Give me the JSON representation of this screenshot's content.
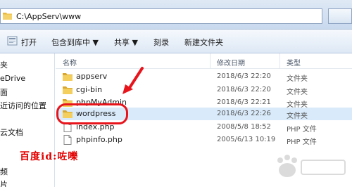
{
  "address_bar": {
    "path": "C:\\AppServ\\www"
  },
  "toolbar": {
    "open_label": "打开",
    "include_library_label": "包含到库中 ▼",
    "share_label": "共享 ▼",
    "burn_label": "刻录",
    "new_folder_label": "新建文件夹"
  },
  "nav_pane": {
    "items": [
      "夹",
      "eDrive",
      "面",
      "近访问的位置",
      "云文档",
      "",
      "频",
      "片"
    ]
  },
  "file_list": {
    "headers": {
      "name": "名称",
      "modified": "修改日期",
      "type": "类型"
    },
    "rows": [
      {
        "name": "appserv",
        "date": "2018/6/3 22:20",
        "type": "文件夹",
        "icon": "folder-icon"
      },
      {
        "name": "cgi-bin",
        "date": "2018/6/3 22:20",
        "type": "文件夹",
        "icon": "folder-icon"
      },
      {
        "name": "phpMyAdmin",
        "date": "2018/6/3 22:21",
        "type": "文件夹",
        "icon": "folder-icon"
      },
      {
        "name": "wordpress",
        "date": "2018/6/3 22:26",
        "type": "文件夹",
        "icon": "folder-icon"
      },
      {
        "name": "index.php",
        "date": "2008/5/8 18:52",
        "type": "PHP 文件",
        "icon": "php-file-icon"
      },
      {
        "name": "phpinfo.php",
        "date": "2005/6/13 10:19",
        "type": "PHP 文件",
        "icon": "php-file-icon"
      }
    ]
  },
  "annotation": {
    "watermark_text": "百度id:咗嚛"
  },
  "colors": {
    "highlight": "#e8141c",
    "selection": "#d9ebfb",
    "folder": "#f2c94c"
  }
}
